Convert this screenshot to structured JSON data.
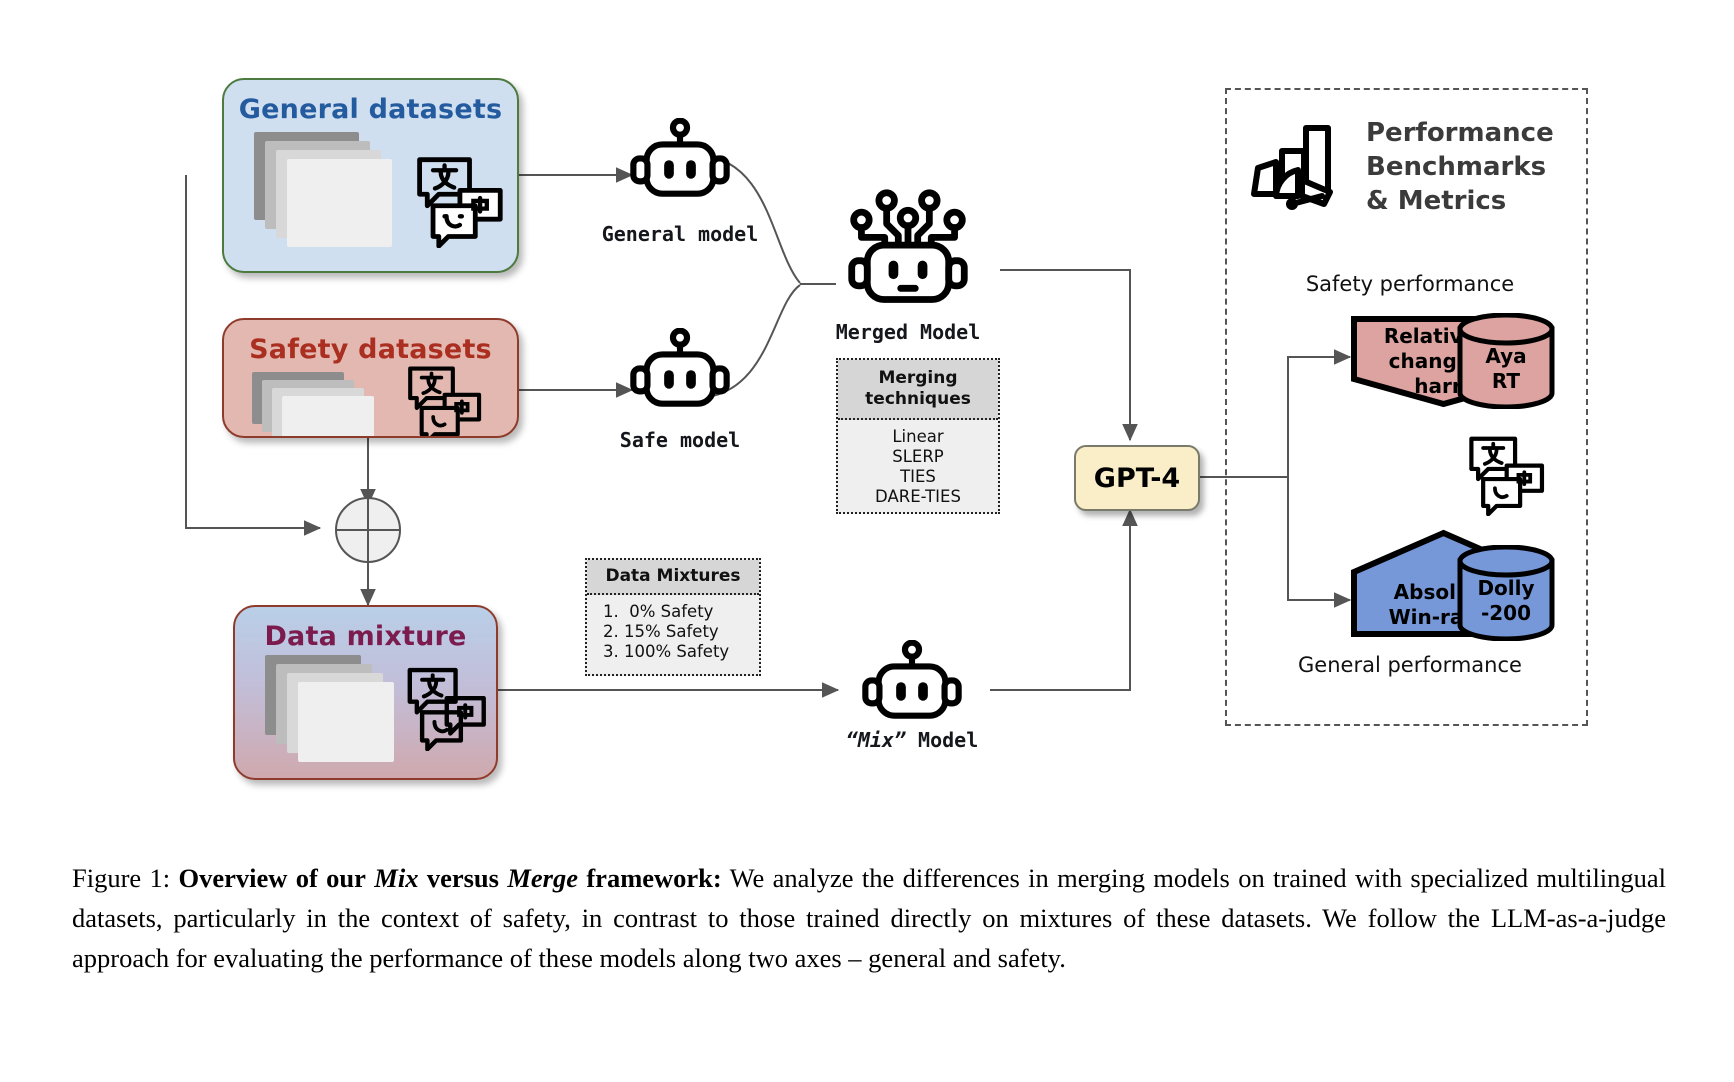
{
  "figure": {
    "cards": {
      "general": {
        "title": "General datasets"
      },
      "safety": {
        "title": "Safety datasets"
      },
      "mixture": {
        "title": "Data mixture"
      }
    },
    "models": {
      "general": "General model",
      "safe": "Safe model",
      "merged": "Merged Model",
      "mix_quote_open": "“",
      "mix_name": "Mix",
      "mix_quote_close": "”",
      "mix_suffix": " Model"
    },
    "merging_box": {
      "header": "Merging\ntechniques",
      "items": [
        "Linear",
        "SLERP",
        "TIES",
        "DARE-TIES"
      ]
    },
    "mixtures_box": {
      "header": "Data Mixtures",
      "items": [
        "1.  0% Safety",
        "2. 15% Safety",
        "3. 100% Safety"
      ]
    },
    "judge": {
      "label": "GPT-4"
    },
    "eval_panel": {
      "title": "Performance\nBenchmarks\n& Metrics",
      "safety_caption": "Safety performance",
      "general_caption": "General performance",
      "safety_metric": "Relative %\nchange in\nharm",
      "safety_dataset": "Aya\nRT",
      "general_metric": "Absolute\nWin-rates",
      "general_dataset": "Dolly\n-200"
    },
    "icons": {
      "translate": "translate-chat-icon",
      "benchmark": "benchmark-chart-icon",
      "robot": "robot-icon",
      "merged_robot": "neural-robot-icon",
      "merge_operator": "circle-plus-operator-icon"
    },
    "colors": {
      "general_blue": "#cfdff0",
      "general_title": "#245a9e",
      "safety_red": "#e3b8b0",
      "safety_title": "#ab2f21",
      "mixture_title": "#7c1c4e",
      "gpt_yellow": "#faeec8",
      "metric_red": "#dca3a0",
      "metric_blue": "#7698d8"
    }
  },
  "caption": {
    "prefix": "Figure 1:",
    "bold_1": "Overview of our",
    "bold_italic_1": "Mix",
    "bold_2": "versus",
    "bold_italic_2": "Merge",
    "bold_3": "framework:",
    "body": "We analyze the differences in merging models on trained with specialized multilingual datasets, particularly in the context of safety, in contrast to those trained directly on mixtures of these datasets. We follow the LLM-as-a-judge approach for evaluating the performance of these models along two axes – general and safety."
  }
}
